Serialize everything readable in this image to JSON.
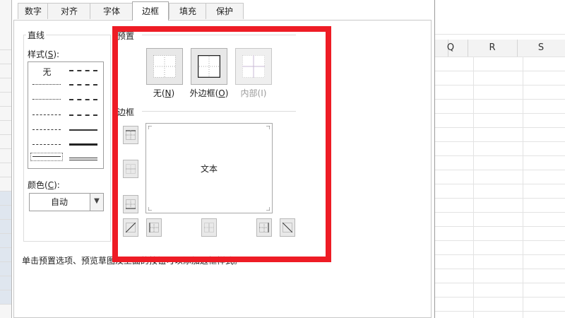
{
  "sheet": {
    "columns": [
      "Q",
      "R",
      "S"
    ]
  },
  "dialog": {
    "tabs": [
      {
        "label": "数字",
        "active": false
      },
      {
        "label": "对齐",
        "active": false
      },
      {
        "label": "字体",
        "active": false
      },
      {
        "label": "边框",
        "active": true
      },
      {
        "label": "填充",
        "active": false
      },
      {
        "label": "保护",
        "active": false
      }
    ],
    "line_group": {
      "title": "直线",
      "style_label": "样式(",
      "style_key": "S",
      "style_suffix": "):",
      "none_label": "无",
      "color_label": "颜色(",
      "color_key": "C",
      "color_suffix": "):",
      "color_value": "自动"
    },
    "presets": {
      "title": "预置",
      "items": [
        {
          "label": "无(",
          "key": "N",
          "suffix": ")",
          "enabled": true
        },
        {
          "label": "外边框(",
          "key": "O",
          "suffix": ")",
          "enabled": true
        },
        {
          "label": "内部(I)",
          "key": "",
          "suffix": "",
          "enabled": false
        }
      ]
    },
    "border": {
      "title": "边框",
      "preview_text": "文本"
    },
    "hint": "单击预置选项、预览草图及上面的按钮可以添加边框样式。"
  },
  "annotation": {
    "highlight_color": "#ee1c25"
  }
}
